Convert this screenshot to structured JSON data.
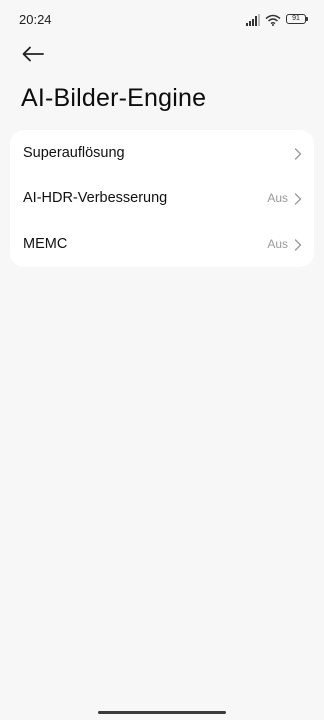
{
  "status_bar": {
    "time": "20:24",
    "battery": "91"
  },
  "header": {
    "title": "AI-Bilder-Engine"
  },
  "settings": {
    "items": [
      {
        "label": "Superauflösung",
        "value": ""
      },
      {
        "label": "AI-HDR-Verbesserung",
        "value": "Aus"
      },
      {
        "label": "MEMC",
        "value": "Aus"
      }
    ]
  },
  "icons": {
    "back": "arrow-left-icon",
    "chevron": "chevron-right-icon",
    "signal": "signal-icon",
    "wifi": "wifi-icon",
    "battery": "battery-icon"
  },
  "colors": {
    "background": "#f7f7f7",
    "card": "#ffffff",
    "secondary_text": "#9a9a9a"
  }
}
